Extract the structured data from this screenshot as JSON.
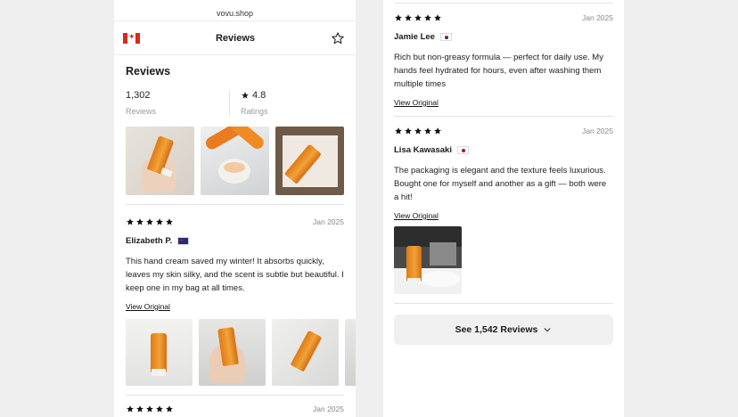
{
  "browser": {
    "url": "vovu.shop"
  },
  "header": {
    "title": "Reviews"
  },
  "summary": {
    "section_title": "Reviews",
    "review_count": "1,302",
    "review_count_label": "Reviews",
    "rating": "4.8",
    "rating_label": "Ratings"
  },
  "reviews": [
    {
      "rating": 5,
      "date": "Jan 2025",
      "author": "Elizabeth P.",
      "flag": "au-flag-icon",
      "text": "This hand cream saved my winter! It absorbs quickly, leaves my skin silky, and the scent is subtle but beautiful. I keep one in my bag at all times.",
      "view_original": "View Original"
    },
    {
      "rating": 5,
      "date": "Jan 2025"
    },
    {
      "rating": 5,
      "date": "Jan 2025",
      "author": "Jamie Lee",
      "flag": "kr-flag-icon",
      "text": "Rich but non-greasy formula — perfect for daily use. My hands feel hydrated for hours, even after washing them multiple times",
      "view_original": "View Original"
    },
    {
      "rating": 5,
      "date": "Jan 2025",
      "author": "Lisa Kawasaki",
      "flag": "jp-flag-icon",
      "text": "The packaging is elegant and the texture feels luxurious. Bought one for myself and another as a gift — both were a hit!",
      "view_original": "View Original"
    }
  ],
  "see_all": {
    "label": "See 1,542 Reviews"
  },
  "colors": {
    "accent": "#1a1a1a",
    "product_orange": "#ee8f24"
  }
}
